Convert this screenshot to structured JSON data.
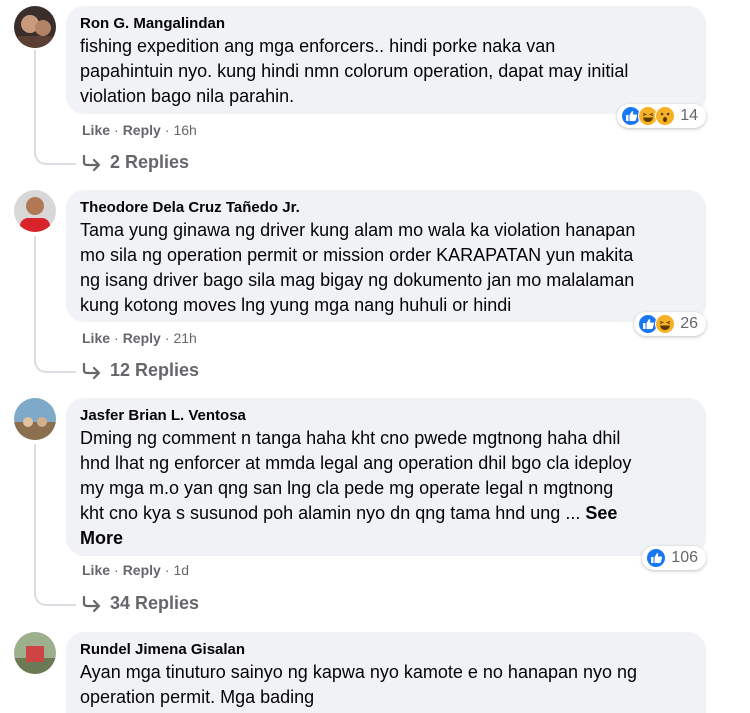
{
  "comments": [
    {
      "author": "Ron G. Mangalindan",
      "text": "fishing expedition ang mga enforcers.. hindi porke naka van\npapahintuin nyo. kung hindi nmn colorum operation, dapat may initial\nviolation bago nila parahin.",
      "see_more": "",
      "like": "Like",
      "reply": "Reply",
      "time": "16h",
      "reactions": [
        "like",
        "haha",
        "wow"
      ],
      "reaction_count": "14",
      "replies": "2 Replies"
    },
    {
      "author": "Theodore Dela Cruz Tañedo Jr.",
      "text": "Tama yung ginawa ng driver kung alam mo wala ka violation hanapan\nmo sila ng operation permit or mission order KARAPATAN yun makita\nng isang driver bago sila mag bigay ng dokumento jan mo malalaman\nkung kotong moves lng yung mga nang huhuli or hindi",
      "see_more": "",
      "like": "Like",
      "reply": "Reply",
      "time": "21h",
      "reactions": [
        "like",
        "haha"
      ],
      "reaction_count": "26",
      "replies": "12 Replies"
    },
    {
      "author": "Jasfer Brian L. Ventosa",
      "text": "Dming ng comment n tanga haha kht cno pwede mgtnong haha dhil\nhnd lhat ng enforcer at mmda legal ang operation dhil bgo cla ideploy\nmy mga m.o yan qng san lng cla pede mg operate legal n mgtnong\nkht cno kya s susunod poh alamin nyo dn qng tama hnd ung ... ",
      "see_more": "See\nMore",
      "like": "Like",
      "reply": "Reply",
      "time": "1d",
      "reactions": [
        "like"
      ],
      "reaction_count": "106",
      "replies": "34 Replies"
    },
    {
      "author": "Rundel Jimena Gisalan",
      "text": "Ayan mga tinuturo sainyo ng kapwa nyo kamote e no hanapan nyo ng\noperation permit. Mga bading",
      "see_more": "",
      "like": "",
      "reply": "",
      "time": "",
      "reactions": [],
      "reaction_count": "",
      "replies": ""
    }
  ],
  "colors": {
    "bubble": "#f0f2f5",
    "meta_text": "#65676b",
    "like_blue": "#1877f2",
    "haha_yellow": "#f7b125"
  }
}
